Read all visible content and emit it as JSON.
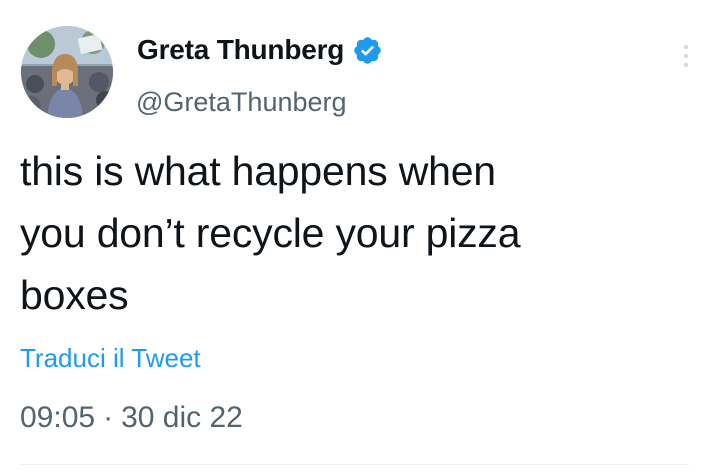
{
  "tweet": {
    "author": {
      "display_name": "Greta Thunberg",
      "username": "@GretaThunberg",
      "verified": true,
      "avatar_icon": "avatar-photo",
      "verified_icon": "verified-badge-icon"
    },
    "text": "this is what happens when\nyou don’t recycle your pizza\nboxes",
    "translate_label": "Traduci il Tweet",
    "time": "09:05",
    "separator": "·",
    "date": "30 dic 22",
    "more_icon": "more-options-icon"
  },
  "colors": {
    "text_primary": "#0f1419",
    "text_secondary": "#536471",
    "link": "#1d9bf0",
    "verified": "#1d9bf0"
  }
}
